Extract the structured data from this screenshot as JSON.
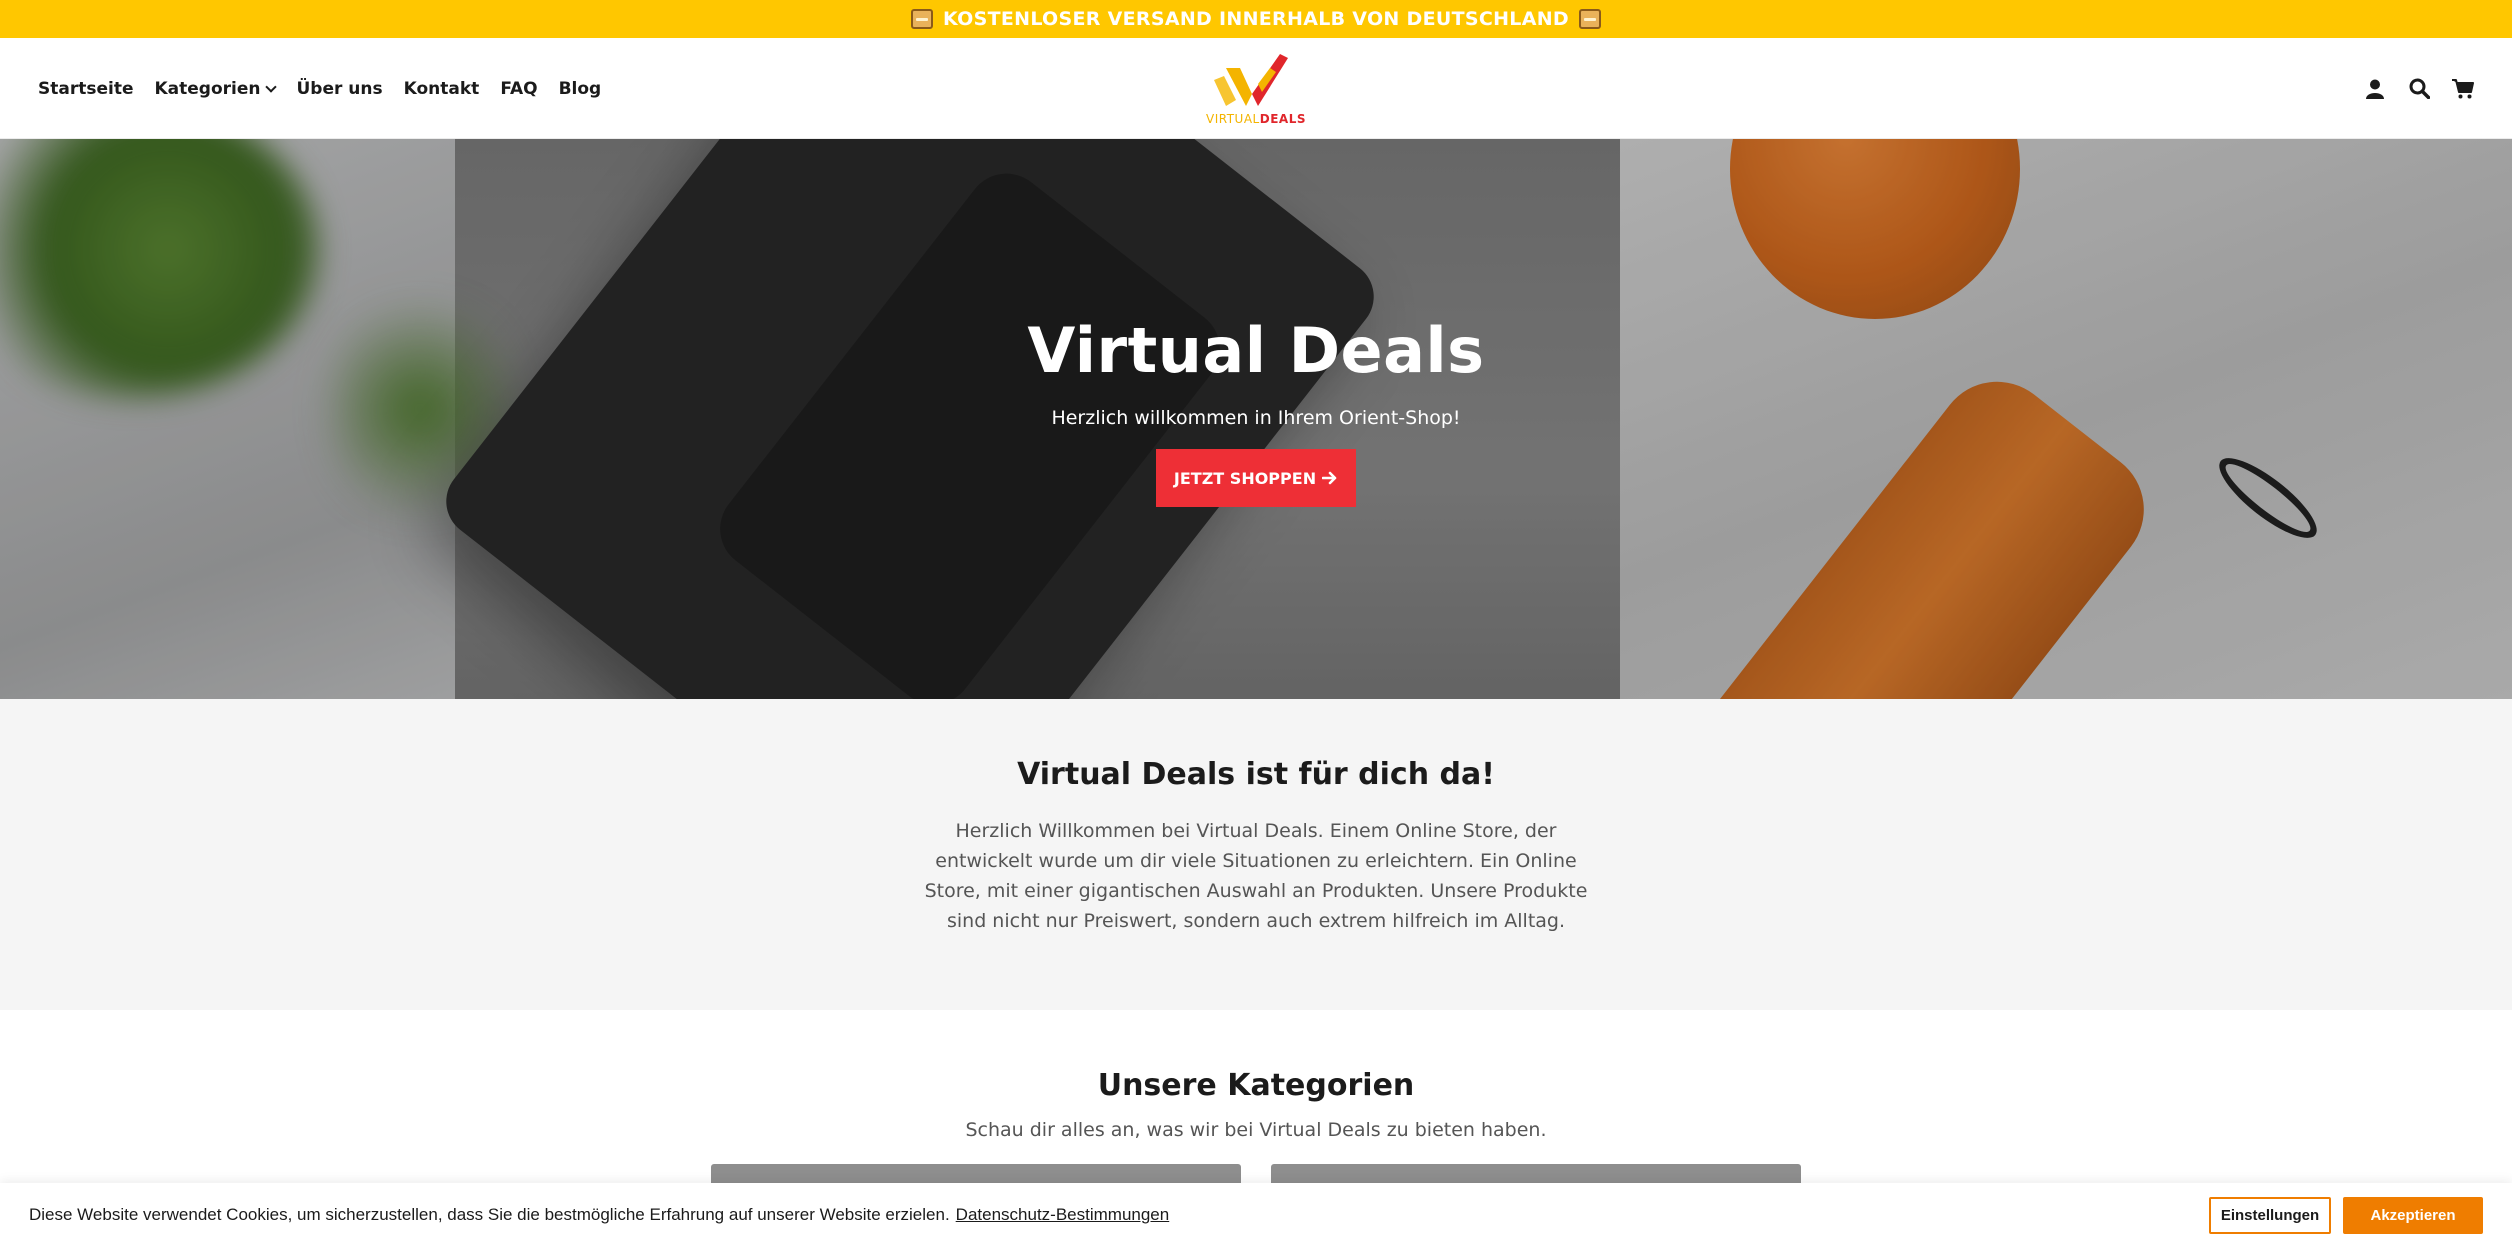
{
  "announcement": {
    "text": "KOSTENLOSER VERSAND INNERHALB VON DEUTSCHLAND",
    "icon": "package-emoji-icon",
    "background": "#ffc700"
  },
  "header": {
    "nav": [
      {
        "label": "Startseite"
      },
      {
        "label": "Kategorien",
        "has_dropdown": true
      },
      {
        "label": "Über uns"
      },
      {
        "label": "Kontakt"
      },
      {
        "label": "FAQ"
      },
      {
        "label": "Blog"
      }
    ],
    "logo": {
      "word1": "VIRTUAL",
      "word2": "DEALS"
    },
    "icons": [
      "account-icon",
      "search-icon",
      "cart-icon"
    ]
  },
  "hero": {
    "title": "Virtual Deals",
    "subtitle": "Herzlich willkommen in Ihrem Orient-Shop!",
    "button_label": "JETZT SHOPPEN",
    "button_color": "#ee2f36"
  },
  "intro": {
    "title": "Virtual Deals ist für dich da!",
    "text": "Herzlich Willkommen bei Virtual Deals. Einem Online Store, der entwickelt wurde um dir viele Situationen zu erleichtern. Ein Online Store, mit einer gigantischen Auswahl an Produkten. Unsere Produkte sind nicht nur Preiswert, sondern auch extrem hilfreich im Alltag."
  },
  "categories": {
    "title": "Unsere Kategorien",
    "subtitle": "Schau dir alles an, was wir bei Virtual Deals zu bieten haben."
  },
  "cookie": {
    "text": "Diese Website verwendet Cookies, um sicherzustellen, dass Sie die bestmögliche Erfahrung auf unserer Website erzielen.",
    "link_label": "Datenschutz-Bestimmungen",
    "settings_label": "Einstellungen",
    "accept_label": "Akzeptieren",
    "accent": "#ef7d00"
  }
}
